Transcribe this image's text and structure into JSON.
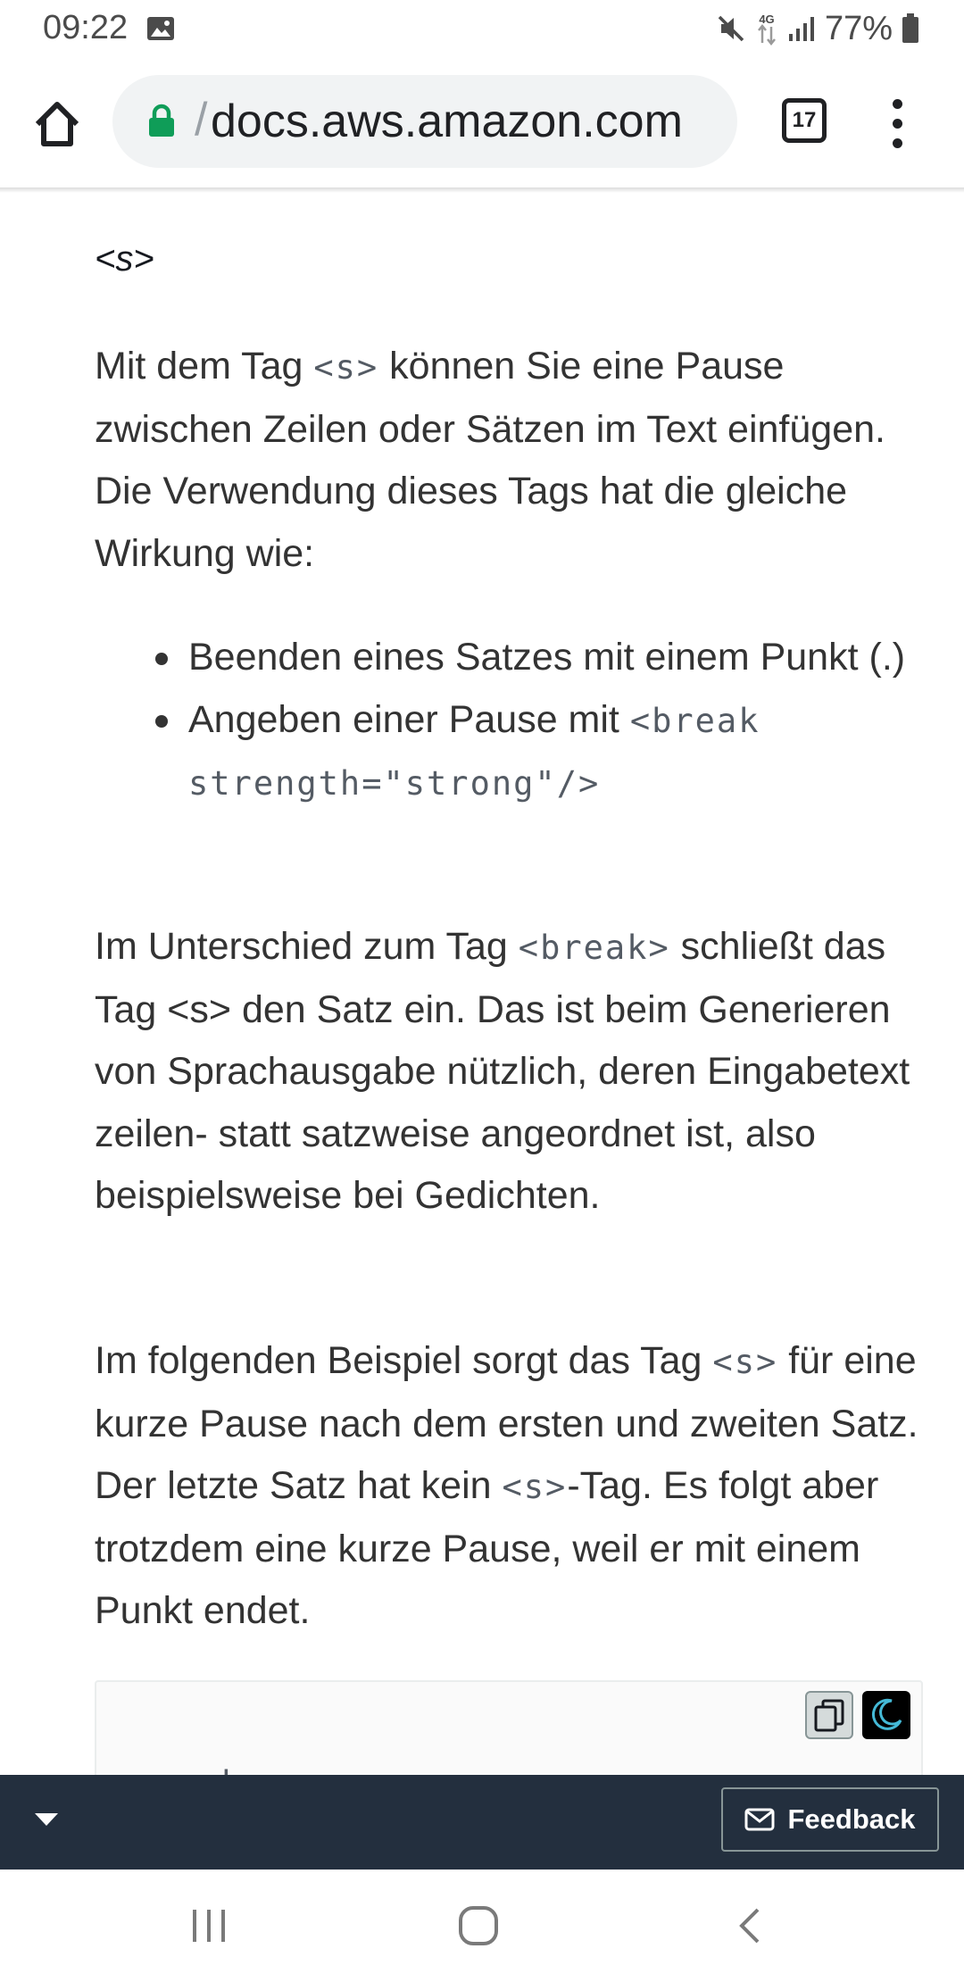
{
  "status_bar": {
    "time": "09:22",
    "battery": "77%",
    "network": "4G",
    "icons": [
      "gallery-icon",
      "mute-icon",
      "data-arrows-icon",
      "signal-icon",
      "battery-icon"
    ]
  },
  "browser": {
    "url_prefix": "/",
    "url": "docs.aws.amazon.com",
    "tab_count": "17",
    "icons": [
      "home-icon",
      "lock-icon",
      "more-vert-icon"
    ]
  },
  "content": {
    "tag_heading": "<s>",
    "para1": {
      "t1": "Mit dem Tag ",
      "code1": "<s>",
      "t2": " können Sie eine Pause zwischen Zeilen oder Sätzen im Text einfügen. Die Verwendung dieses Tags hat die gleiche Wirkung wie:"
    },
    "bullets": {
      "b1": "Beenden eines Satzes mit einem Punkt (.)",
      "b2_text": "Angeben einer Pause mit ",
      "b2_code": "<break strength=\"strong\"/>"
    },
    "para2": {
      "t1": "Im Unterschied zum Tag ",
      "code1": "<break>",
      "t2": " schließt das Tag <s> den Satz ein. Das ist beim Generieren von Sprachausgabe nützlich, deren Eingabetext zeilen- statt satzweise angeordnet ist, also beispielsweise bei Gedichten."
    },
    "para3": {
      "t1": "Im folgenden Beispiel sorgt das Tag ",
      "code1": "<s>",
      "t2": " für eine kurze Pause nach dem ersten und zweiten Satz. Der letzte Satz hat kein ",
      "code2": "<s>",
      "t3": "-Tag. Es folgt aber trotzdem eine kurze Pause, weil er mit einem Punkt endet."
    },
    "code_block": {
      "first_line": "<speak>",
      "icons": [
        "copy-icon",
        "moon-icon"
      ]
    }
  },
  "feedback_bar": {
    "feedback_label": "Feedback",
    "icons": [
      "chevron-down-icon",
      "mail-icon"
    ]
  },
  "nav_bar": {
    "icons": [
      "recents-icon",
      "home-circle-icon",
      "back-icon"
    ]
  },
  "colors": {
    "link_blue": "#0073bb",
    "feedback_bar_bg": "#232f3e",
    "lock_green": "#0f9d58",
    "moon_blue": "#44b9d6"
  }
}
